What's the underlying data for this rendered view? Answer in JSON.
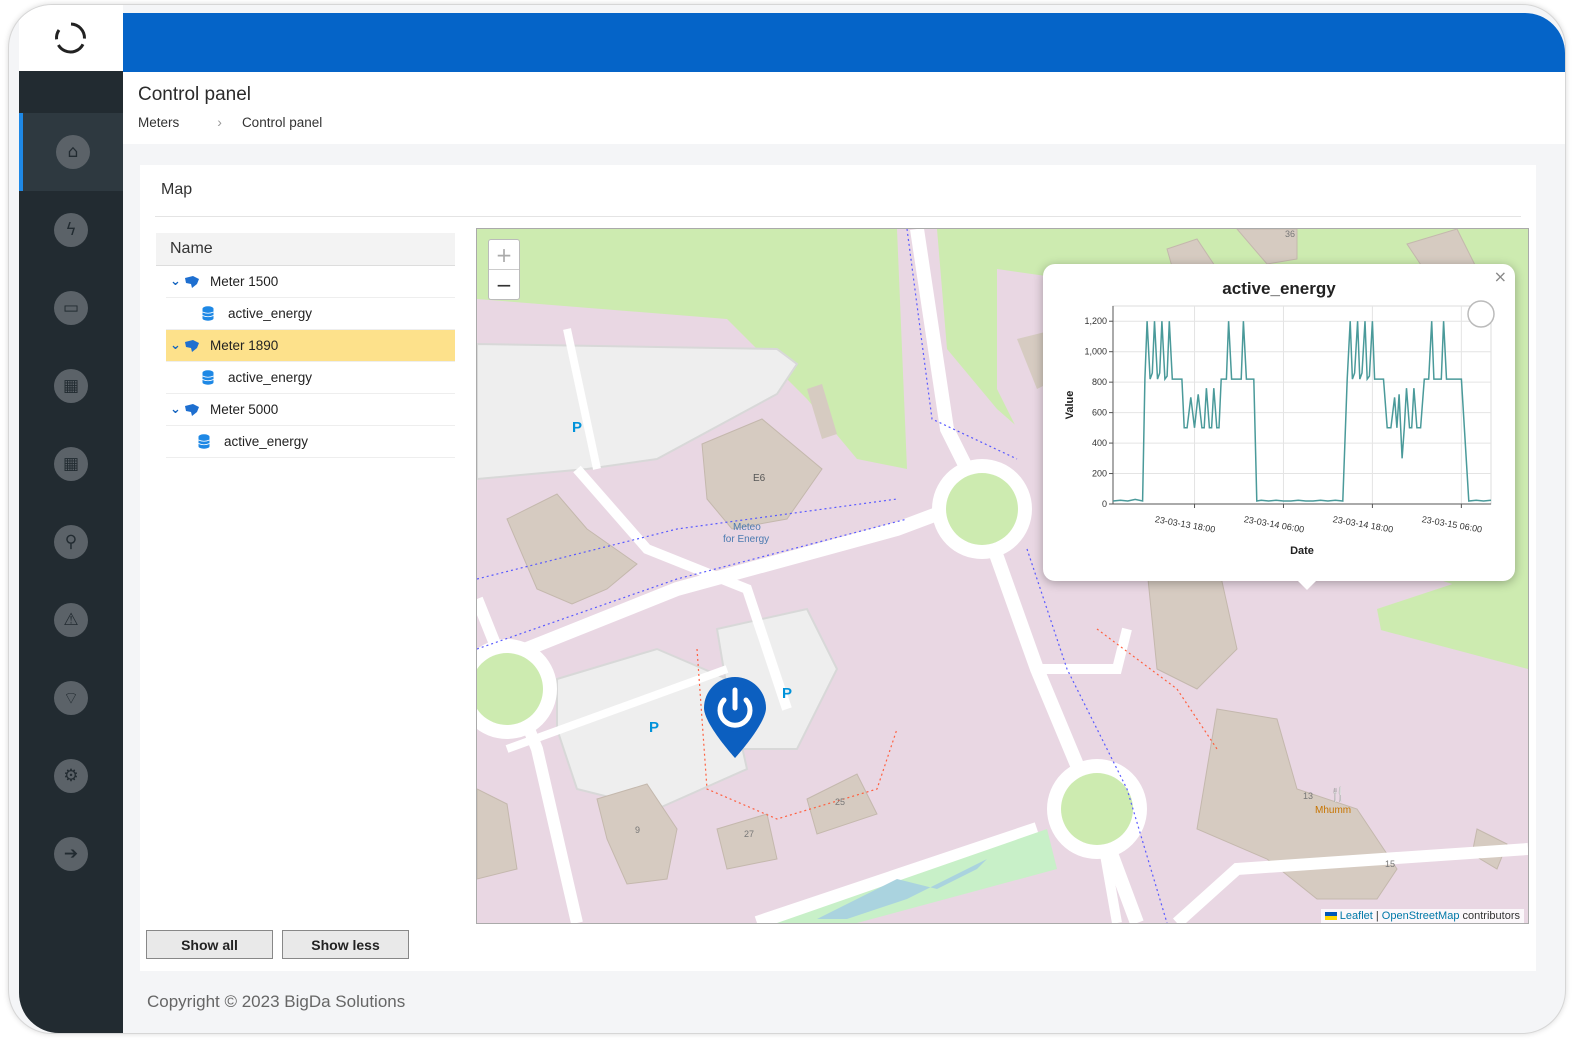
{
  "header": {
    "title": "Control panel",
    "breadcrumb": [
      "Meters",
      "Control panel"
    ]
  },
  "sidebar": {
    "items": [
      {
        "icon": "home-icon",
        "glyph": "⌂",
        "active": true
      },
      {
        "icon": "bolt-icon",
        "glyph": "ϟ"
      },
      {
        "icon": "monitor-icon",
        "glyph": "▭"
      },
      {
        "icon": "table-icon",
        "glyph": "▦"
      },
      {
        "icon": "table-icon",
        "glyph": "▦"
      },
      {
        "icon": "search-icon",
        "glyph": "⚲"
      },
      {
        "icon": "warning-icon",
        "glyph": "⚠"
      },
      {
        "icon": "wifi-icon",
        "glyph": "⌔"
      },
      {
        "icon": "gear-icon",
        "glyph": "⚙"
      },
      {
        "icon": "logout-icon",
        "glyph": "➔"
      }
    ]
  },
  "card": {
    "title": "Map"
  },
  "tree": {
    "header": "Name",
    "meters": [
      {
        "name": "Meter 1500",
        "selected": false,
        "child": "active_energy"
      },
      {
        "name": "Meter 1890",
        "selected": true,
        "child": "active_energy"
      },
      {
        "name": "Meter 5000",
        "selected": false,
        "child": "active_energy"
      }
    ]
  },
  "buttons": {
    "show_all": "Show all",
    "show_less": "Show less"
  },
  "map": {
    "zoom_in": "+",
    "zoom_out": "−",
    "attribution_leaflet": "Leaflet",
    "attribution_osm": "OpenStreetMap",
    "attribution_rest": "contributors",
    "labels": {
      "parking": "P",
      "building_e6": "E6",
      "meteo": "Meteo",
      "for_energy": "for Energy",
      "n9": "9",
      "n25": "25",
      "n27": "27",
      "n13": "13",
      "n15": "15",
      "n36": "36",
      "mhumm": "Mhumm"
    }
  },
  "popup": {
    "close": "×",
    "chart_data": {
      "type": "line",
      "title": "active_energy",
      "xlabel": "Date",
      "ylabel": "Value",
      "ylim": [
        0,
        1300
      ],
      "y_ticks": [
        0,
        200,
        400,
        600,
        800,
        1000,
        1200
      ],
      "y_tick_labels": [
        "0",
        "200",
        "400",
        "600",
        "800",
        "1,000",
        "1,200"
      ],
      "x_tick_labels": [
        "23-03-13 18:00",
        "23-03-14 06:00",
        "23-03-14 18:00",
        "23-03-15 06:00"
      ],
      "x_tick_hours": [
        18,
        30,
        42,
        54
      ],
      "xlim_hours": [
        7,
        58
      ],
      "series_color": "#4a9a9a",
      "series": [
        {
          "x": [
            7,
            8,
            9,
            10,
            11,
            11.3,
            11.6,
            12,
            12.3,
            12.6,
            13,
            13.3,
            13.6,
            14,
            14.3,
            14.6,
            15,
            15.3,
            15.6,
            16,
            16.3,
            16.6,
            17,
            17.5,
            18,
            18.5,
            19,
            19.3,
            19.6,
            20,
            20.3,
            20.6,
            21,
            21.3,
            21.6,
            22,
            22.3,
            22.6,
            23,
            23.5,
            24,
            24.3,
            24.6,
            25,
            25.3,
            25.6,
            26,
            26.4,
            27,
            28,
            29,
            30,
            31,
            32,
            33,
            34,
            35,
            36,
            37,
            38,
            38.6,
            39,
            39.3,
            39.6,
            40,
            40.3,
            40.6,
            41,
            41.3,
            41.6,
            42,
            42.3,
            42.6,
            43,
            43.5,
            44,
            44.5,
            45,
            45.3,
            45.6,
            46,
            46.3,
            46.6,
            47,
            47.3,
            47.6,
            48,
            48.5,
            49,
            49.3,
            49.6,
            50,
            50.3,
            50.6,
            51,
            51.3,
            51.6,
            52,
            52.4,
            53,
            54,
            55,
            56,
            57,
            58
          ],
          "y": [
            20,
            25,
            20,
            30,
            20,
            820,
            1200,
            820,
            860,
            1200,
            820,
            860,
            1200,
            820,
            840,
            1200,
            820,
            820,
            820,
            820,
            820,
            500,
            500,
            700,
            500,
            720,
            500,
            500,
            760,
            500,
            500,
            760,
            500,
            500,
            820,
            820,
            820,
            1200,
            820,
            820,
            820,
            820,
            1200,
            820,
            820,
            820,
            820,
            20,
            25,
            20,
            25,
            20,
            20,
            25,
            20,
            20,
            25,
            20,
            25,
            20,
            820,
            1200,
            820,
            860,
            1200,
            820,
            860,
            1200,
            820,
            840,
            1200,
            820,
            820,
            820,
            820,
            500,
            500,
            700,
            500,
            720,
            300,
            500,
            760,
            500,
            500,
            760,
            500,
            500,
            820,
            820,
            820,
            1200,
            820,
            820,
            820,
            820,
            1200,
            820,
            820,
            820,
            820,
            20,
            25,
            20,
            25,
            20,
            20
          ]
        }
      ]
    }
  },
  "footer": {
    "copyright": "Copyright © 2023 BigDa Solutions"
  }
}
